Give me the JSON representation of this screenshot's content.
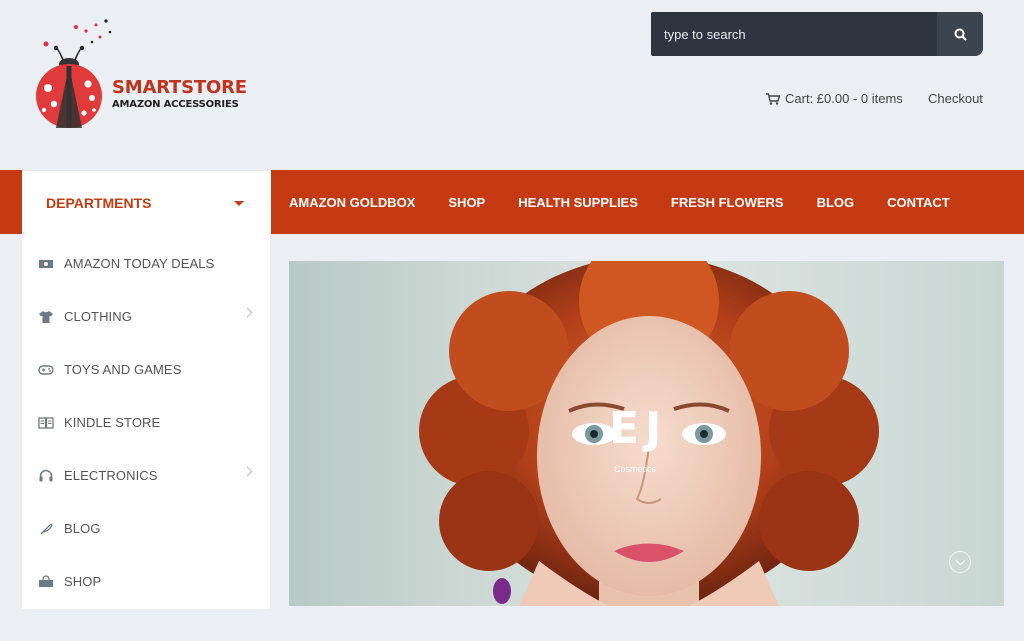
{
  "brand": {
    "name": "SMARTSTORE",
    "tagline": "AMAZON ACCESSORIES",
    "accent_color": "#c53a12"
  },
  "search": {
    "placeholder": "type to search",
    "icon": "search-icon"
  },
  "header_links": {
    "cart_label": "Cart: £0.00 - 0 items",
    "checkout_label": "Checkout"
  },
  "departments": {
    "label": "DEPARTMENTS"
  },
  "nav": {
    "items": [
      {
        "label": "AMAZON GOLDBOX"
      },
      {
        "label": "SHOP"
      },
      {
        "label": "HEALTH SUPPLIES"
      },
      {
        "label": "FRESH FLOWERS"
      },
      {
        "label": "BLOG"
      },
      {
        "label": "CONTACT"
      }
    ]
  },
  "sidebar": {
    "items": [
      {
        "label": "AMAZON TODAY DEALS",
        "icon": "money-icon"
      },
      {
        "label": "CLOTHING",
        "icon": "tshirt-icon",
        "has_submenu": true
      },
      {
        "label": "TOYS AND GAMES",
        "icon": "gamepad-icon"
      },
      {
        "label": "KINDLE STORE",
        "icon": "book-icon"
      },
      {
        "label": "ELECTRONICS",
        "icon": "headphones-icon",
        "has_submenu": true
      },
      {
        "label": "BLOG",
        "icon": "feather-icon"
      },
      {
        "label": "SHOP",
        "icon": "basket-icon"
      }
    ]
  },
  "hero": {
    "mark": "EJ",
    "caption": "Cosmetics"
  }
}
